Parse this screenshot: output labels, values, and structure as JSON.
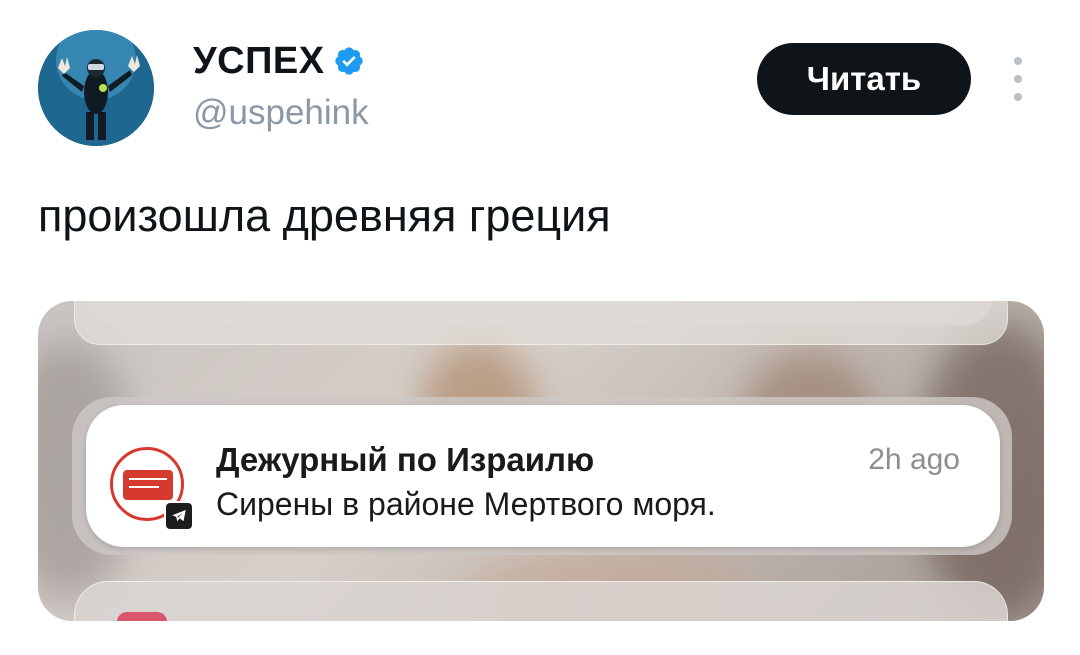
{
  "account": {
    "name": "УСПЕХ",
    "handle": "@uspehink",
    "follow_label": "Читать"
  },
  "tweet": {
    "text": "произошла древняя греция"
  },
  "notification": {
    "app_title": "Дежурный по Израилю",
    "time": "2h ago",
    "message": "Сирены в районе Мертвого моря."
  },
  "colors": {
    "follow_button_bg": "#0f1419",
    "verified_badge": "#1d9bf0",
    "app_icon_red": "#d63a2f"
  },
  "icons": {
    "verified": "verified-badge-icon",
    "more": "more-vertical-icon",
    "telegram": "telegram-icon"
  }
}
